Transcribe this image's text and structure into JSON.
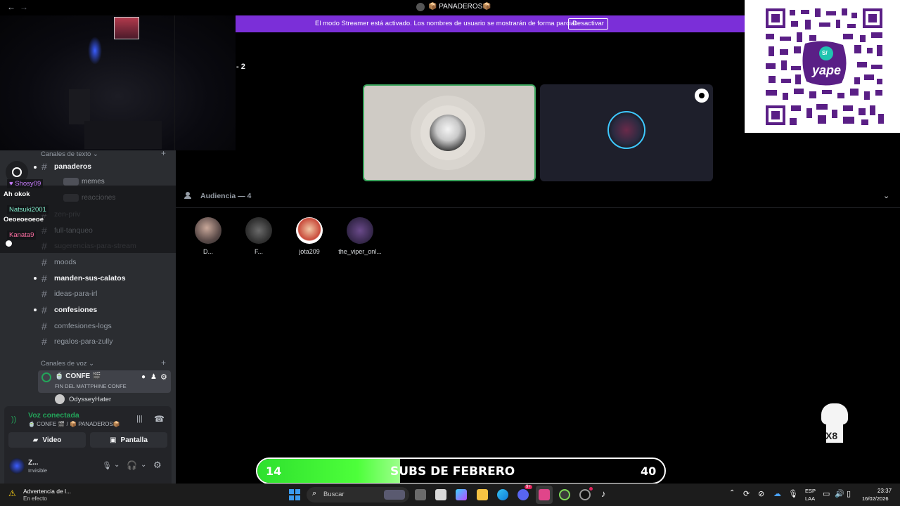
{
  "titlebar": {
    "back": "←",
    "forward": "→",
    "server_title": "📦 PANADEROS📦"
  },
  "banner": {
    "text": "El modo Streamer está activado. Los nombres de usuario se mostrarán de forma parcial.",
    "button": "Desactivar"
  },
  "header_fragment": "- 2",
  "sidebar": {
    "text_category": "Canales de texto",
    "voice_category": "Canales de voz",
    "channels": [
      {
        "name": "panaderos",
        "unread": true
      },
      {
        "name": "memes",
        "unread": false
      },
      {
        "name": "reacciones",
        "unread": false
      },
      {
        "name": "zen-priv",
        "unread": false
      },
      {
        "name": "full-tanqueo",
        "unread": false
      },
      {
        "name": "sugerencias-para-stream",
        "unread": false
      },
      {
        "name": "moods",
        "unread": false
      },
      {
        "name": "manden-sus-calatos",
        "unread": true
      },
      {
        "name": "ideas-para-irl",
        "unread": false
      },
      {
        "name": "confesiones",
        "unread": true
      },
      {
        "name": "comfesiones-logs",
        "unread": false
      },
      {
        "name": "regalos-para-zully",
        "unread": false
      }
    ],
    "voice_channel": {
      "name": "🍵 CONFE 🎬",
      "status": "FIN DEL MATTPHINE CONFE",
      "member": "OdysseyHater"
    }
  },
  "chat_overlay": [
    {
      "user": "Shosy09",
      "message": "Ah okok",
      "color": "#c77dff"
    },
    {
      "user": "Natsuki2001",
      "message": "Oeoeoeoeoe",
      "color": "#7ee8c7"
    },
    {
      "user": "Kanata9",
      "message": "",
      "color": "#ff6fa3"
    }
  ],
  "voice_panel": {
    "status": "Voz conectada",
    "location": "🍵 CONFE 🎬 / 📦 PANADEROS📦",
    "video_button": "Video",
    "screen_button": "Pantalla"
  },
  "user_panel": {
    "name": "Z...",
    "status": "Invisible"
  },
  "stage": {
    "audience_label": "Audiencia — 4",
    "audience": [
      {
        "name": "D..."
      },
      {
        "name": "F..."
      },
      {
        "name": "jota209"
      },
      {
        "name": "the_viper_onl..."
      }
    ]
  },
  "subs_bar": {
    "current": "14",
    "label": "SUBS DE FEBRERO",
    "goal": "40",
    "progress": 0.35
  },
  "qr": {
    "brand": "yape",
    "badge": "S/"
  },
  "overlay_badge": "X8",
  "taskbar": {
    "notification_title": "Advertencia de l...",
    "notification_sub": "En efecto",
    "search_placeholder": "Buscar",
    "lang_top": "ESP",
    "lang_bottom": "LAA",
    "time": "23:37",
    "date": "16/02/2026",
    "discord_badge": "9+"
  }
}
